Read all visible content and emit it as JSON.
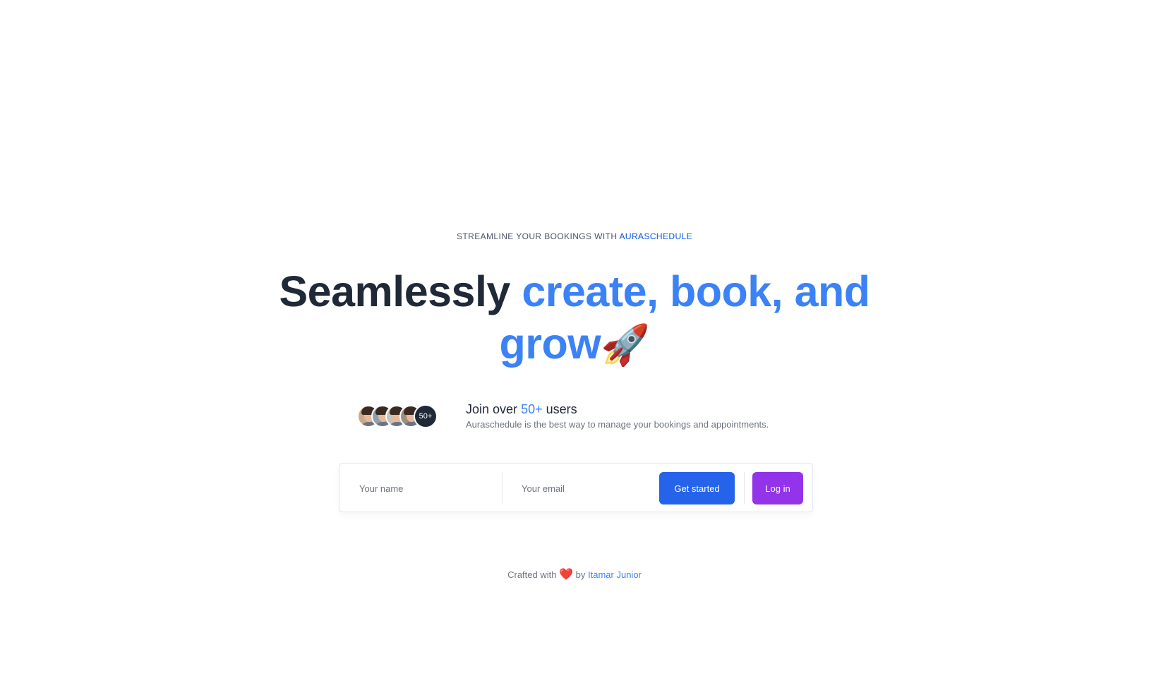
{
  "hero": {
    "eyebrow_prefix": "STREAMLINE YOUR BOOKINGS WITH",
    "eyebrow_brand": "AURASCHEDULE",
    "headline_plain": "Seamlessly",
    "headline_accent_line1": "create, book, and",
    "headline_accent_line2": "grow",
    "headline_emoji": "🚀"
  },
  "social_proof": {
    "avatar_count_badge": "50+",
    "title_prefix": "Join over",
    "title_number": "50+",
    "title_suffix": "users",
    "subtitle": "Auraschedule is the best way to manage your bookings and appointments."
  },
  "signup_form": {
    "name_placeholder": "Your name",
    "email_placeholder": "Your email",
    "get_started_label": "Get started",
    "login_label": "Log in"
  },
  "footer": {
    "prefix": "Crafted with",
    "heart": "❤️",
    "by": "by",
    "author": "Itamar Junior"
  },
  "colors": {
    "accent": "#3b82f6",
    "primary_button": "#2563eb",
    "login_button": "#9333ea",
    "heading": "#1f2937"
  }
}
